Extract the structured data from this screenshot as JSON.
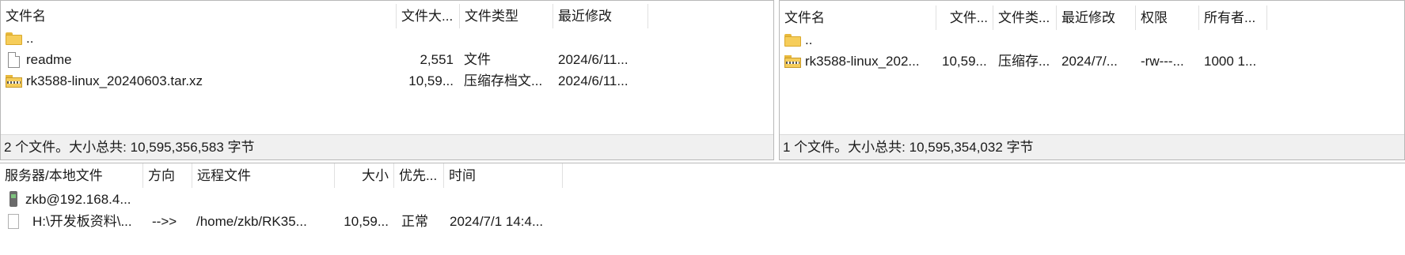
{
  "local": {
    "columns": [
      "文件名",
      "文件大...",
      "文件类型",
      "最近修改"
    ],
    "sort_arrow": "^",
    "rows": [
      {
        "name": "..",
        "size": "",
        "type": "",
        "modified": "",
        "icon": "folder-icon"
      },
      {
        "name": "readme",
        "size": "2,551",
        "type": "文件",
        "modified": "2024/6/11...",
        "icon": "file-icon"
      },
      {
        "name": "rk3588-linux_20240603.tar.xz",
        "size": "10,59...",
        "type": "压缩存档文...",
        "modified": "2024/6/11...",
        "icon": "archive-icon"
      }
    ],
    "status": "2 个文件。大小总共: 10,595,356,583 字节"
  },
  "remote": {
    "columns": [
      "文件名",
      "文件...",
      "文件类...",
      "最近修改",
      "权限",
      "所有者..."
    ],
    "sort_arrow": "^",
    "rows": [
      {
        "name": "..",
        "size": "",
        "type": "",
        "modified": "",
        "perms": "",
        "owner": "",
        "icon": "folder-icon"
      },
      {
        "name": "rk3588-linux_202...",
        "size": "10,59...",
        "type": "压缩存...",
        "modified": "2024/7/...",
        "perms": "-rw---...",
        "owner": "1000 1...",
        "icon": "archive-icon"
      }
    ],
    "status": "1 个文件。大小总共: 10,595,354,032 字节"
  },
  "queue": {
    "columns": [
      "服务器/本地文件",
      "方向",
      "远程文件",
      "大小",
      "优先...",
      "时间"
    ],
    "server": {
      "label": "zkb@192.168.4...",
      "icon": "server-icon"
    },
    "transfer": {
      "local_file": "H:\\开发板资料\\...",
      "direction": "-->>",
      "remote_file": "/home/zkb/RK35...",
      "size": "10,59...",
      "priority": "正常",
      "time": "2024/7/1 14:4..."
    }
  }
}
